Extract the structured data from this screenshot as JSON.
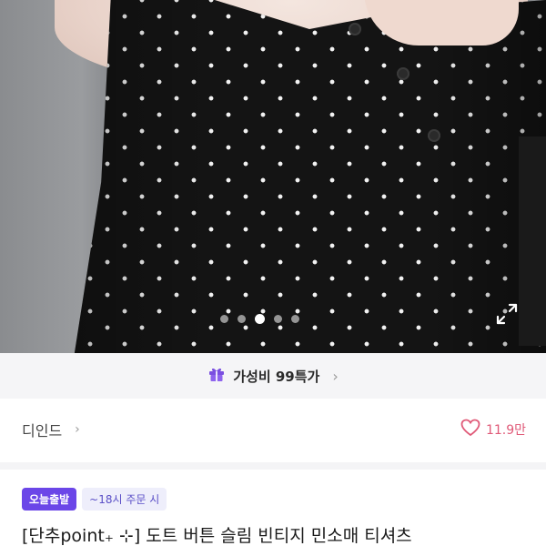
{
  "product_image": {
    "carousel_total": 5,
    "carousel_active_index": 2
  },
  "promo_banner": {
    "icon": "gift-icon",
    "label": "가성비 99특가",
    "chevron": "›"
  },
  "seller": {
    "name": "디인드",
    "chevron": "›",
    "like_icon": "heart-outline-icon",
    "like_count": "11.9만"
  },
  "tags": {
    "primary": "오늘출발",
    "secondary": "~18시 주문 시"
  },
  "product": {
    "title": "[단추point₊ ⊹] 도트 버튼 슬림 빈티지 민소매 티셔츠"
  },
  "colors": {
    "accent": "#6b46e8",
    "like": "#e05a78",
    "promo_bg": "#f5f5f7"
  }
}
